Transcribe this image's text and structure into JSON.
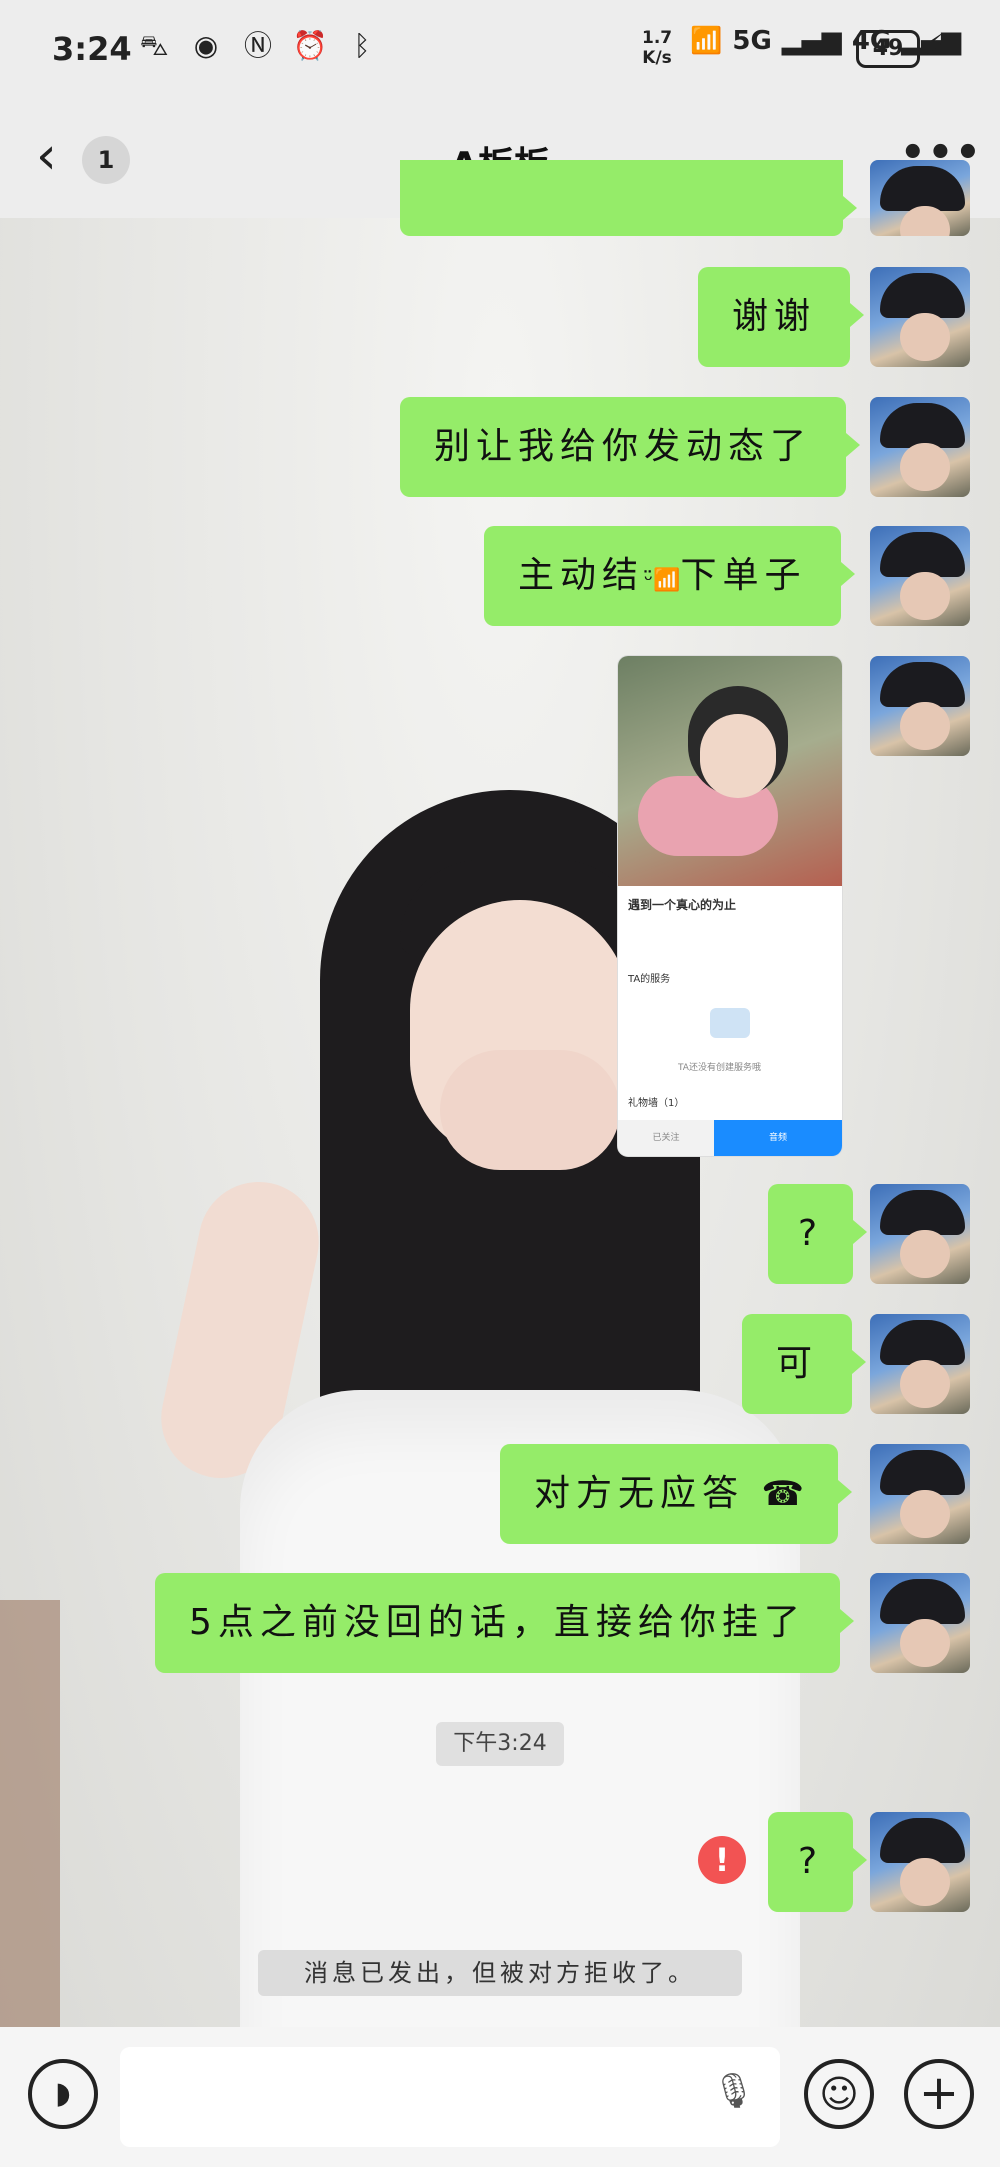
{
  "status_bar": {
    "time": "3:24",
    "net_speed_value": "1.7",
    "net_speed_unit": "K/s",
    "sig1": "5G",
    "sig2": "4G",
    "battery": "49"
  },
  "header": {
    "unread_count": "1",
    "title": "A板板"
  },
  "messages": [
    {
      "text": "谢谢"
    },
    {
      "text": "别让我给你发动态了"
    },
    {
      "text": "主动结"
    },
    {
      "text_after_icon": "下单子"
    },
    {
      "text": "?"
    },
    {
      "text": "可"
    },
    {
      "text": "对方无应答"
    },
    {
      "text": "5点之前没回的话，直接给你挂了"
    },
    {
      "text": "?"
    }
  ],
  "image_message": {
    "caption": "遇到一个真心的为止",
    "section": "TA的服务",
    "empty_text": "TA还没有创建服务哦",
    "list_item": "礼物墙（1）",
    "btn_left": "已关注",
    "btn_right": "音频"
  },
  "timestamp": "下午3:24",
  "notice": "消息已发出，但被对方拒收了。",
  "colors": {
    "bubble": "#95ec69",
    "error": "#f25353"
  }
}
